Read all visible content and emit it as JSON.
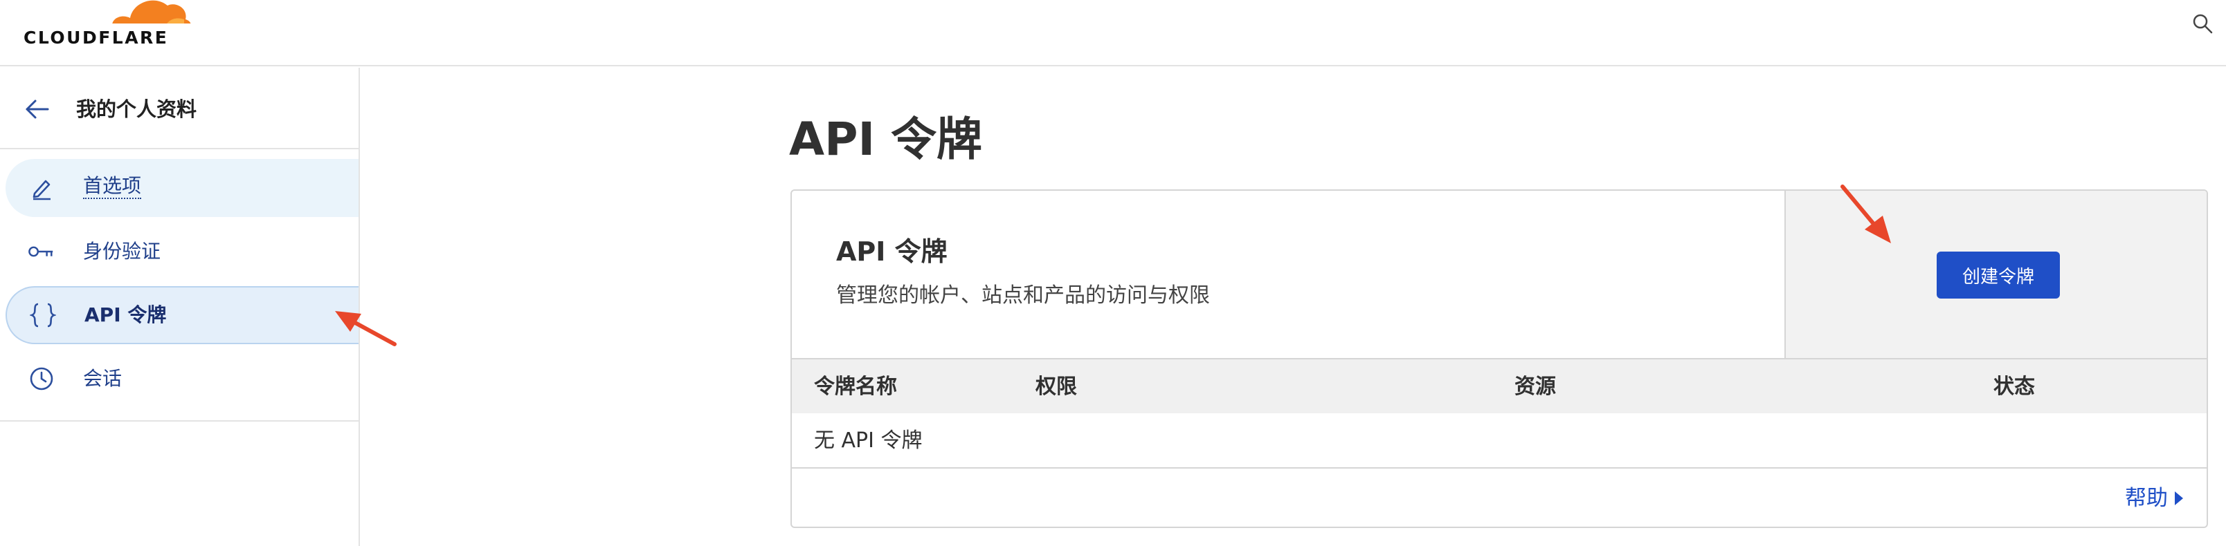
{
  "header": {
    "logo_text": "CLOUDFLARE",
    "logo_icon": "cloud-icon",
    "search_icon": "search-icon",
    "brand_orange": "#f38020"
  },
  "sidebar": {
    "title": "我的个人资料",
    "back_icon": "arrow-left-icon",
    "items": [
      {
        "label": "首选项",
        "icon": "pencil-icon",
        "state": "hover"
      },
      {
        "label": "身份验证",
        "icon": "key-icon",
        "state": "normal"
      },
      {
        "label": "API 令牌",
        "icon": "braces-icon",
        "state": "active"
      },
      {
        "label": "会话",
        "icon": "clock-icon",
        "state": "normal"
      }
    ]
  },
  "main": {
    "page_title": "API 令牌",
    "card": {
      "title": "API 令牌",
      "description": "管理您的帐户、站点和产品的访问与权限",
      "create_button": "创建令牌",
      "columns": [
        "令牌名称",
        "权限",
        "资源",
        "状态"
      ],
      "empty_text": "无 API 令牌",
      "help_link": "帮助",
      "help_icon": "caret-right-icon"
    }
  },
  "colors": {
    "accent_blue": "#1f4fc7",
    "annotation_red": "#e8472b",
    "active_bg": "#e4effa"
  }
}
